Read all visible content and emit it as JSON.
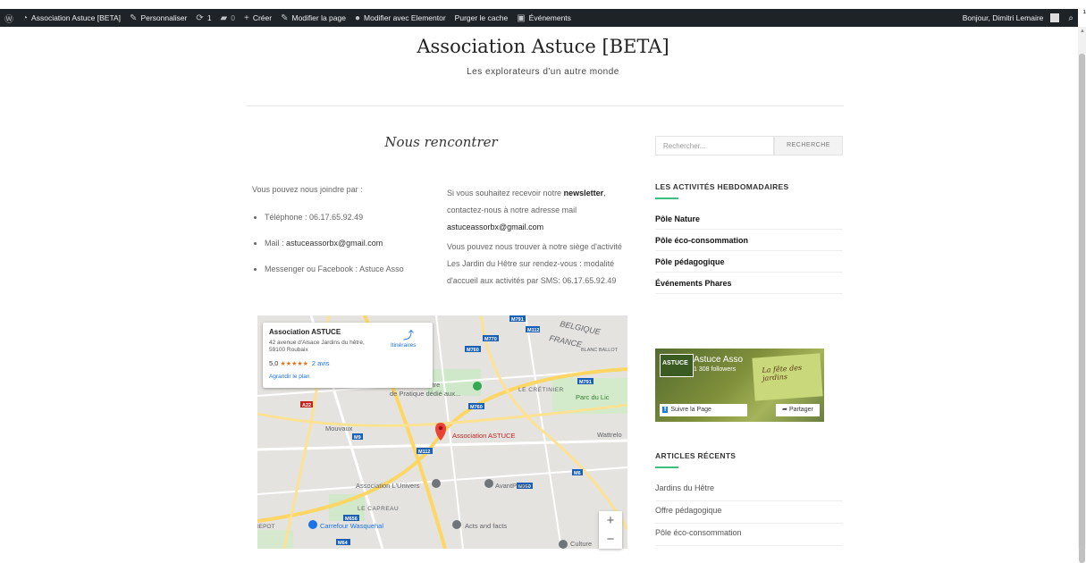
{
  "adminbar": {
    "wp_logo": "wordpress-icon",
    "site_name": "Association Astuce [BETA]",
    "customize": "Personnaliser",
    "updates_count": "1",
    "comments_count": "0",
    "new": "Créer",
    "edit_page": "Modifier la page",
    "edit_elementor": "Modifier avec Elementor",
    "purge_cache": "Purger le cache",
    "events": "Événements",
    "greeting": "Bonjour, Dimitri Lemaire"
  },
  "header": {
    "title": "Association Astuce [BETA]",
    "tagline": "Les explorateurs d'un autre monde"
  },
  "main": {
    "page_title": "Nous rencontrer",
    "col1": {
      "intro": "Vous pouvez nous joindre par :",
      "items": [
        {
          "label": "Téléphone : ",
          "value": "06.17.65.92.49"
        },
        {
          "label": "Mail : ",
          "value": "astuceassorbx@gmail.com"
        },
        {
          "label": "Messenger ou Facebook : ",
          "value": "Astuce Asso"
        }
      ]
    },
    "col2": {
      "p1_a": "Si vous souhaitez recevoir notre ",
      "p1_b": "newsletter",
      "p1_c": ", contactez-nous à notre adresse mail ",
      "p1_mail": "astuceassorbx@gmail.com",
      "p2": "Vous pouvez nous trouver à notre siège d'activité Les Jardin du Hêtre sur rendez-vous : modalité d'accueil aux activités par SMS: 06.17.65.92.49"
    },
    "map": {
      "card_name": "Association ASTUCE",
      "card_address": "42 avenue d'Alsace Jardins du hêtre, 59100 Roubaix",
      "rating": "5,0",
      "stars": "★★★★★",
      "reviews": "2 avis",
      "enlarge": "Agrandir le plan",
      "directions": "Itinéraires",
      "labels": {
        "belgique": "BELGIQUE",
        "france": "FRANCE",
        "blanc_ballot": "BLANC BALLOT",
        "centre": "UM Centre",
        "centre2": "de Pratique dédié aux...",
        "cretinier": "LE CRÉTINIER",
        "parc": "Parc du Lic",
        "mouvaux": "Mouvaux",
        "astuce": "Association ASTUCE",
        "wattrelos": "Wattrelo",
        "univers": "Association L'Univers",
        "avantposte": "AvantPoste",
        "capreau": "LE CAPREAU",
        "carrefour": "Carrefour Wasquehal",
        "acts": "Acts and facts",
        "culture": "Culture",
        "epot": "IEPOT",
        "roads": [
          "M791",
          "M112",
          "M770",
          "M760",
          "M791",
          "M760",
          "M6",
          "M112",
          "M9",
          "M6",
          "A22",
          "M656",
          "M760",
          "M64",
          "M9"
        ]
      },
      "zoom_in": "+",
      "zoom_out": "−"
    }
  },
  "sidebar": {
    "search_placeholder": "Rechercher...",
    "search_button": "RECHERCHE",
    "activities_title": "LES ACTIVITÉS HEBDOMADAIRES",
    "activities": [
      "Pôle Nature",
      "Pôle éco-consommation",
      "Pôle pédagogique",
      "Événements Phares"
    ],
    "fb_name": "Astuce Asso",
    "fb_followers": "1 308 followers",
    "fb_logo": "ASTUCE",
    "fb_follow": "Suivre la Page",
    "fb_share": "Partager",
    "fb_poster": "La fête des jardins",
    "recent_title": "ARTICLES RÉCENTS",
    "recent": [
      "Jardins du Hêtre",
      "Offre pédagogique",
      "Pôle éco-consommation"
    ]
  },
  "colors": {
    "adminbar_bg": "#1d2327",
    "accent": "#3fbf7f",
    "link": "#1a73e8",
    "pin": "#ea4335"
  }
}
